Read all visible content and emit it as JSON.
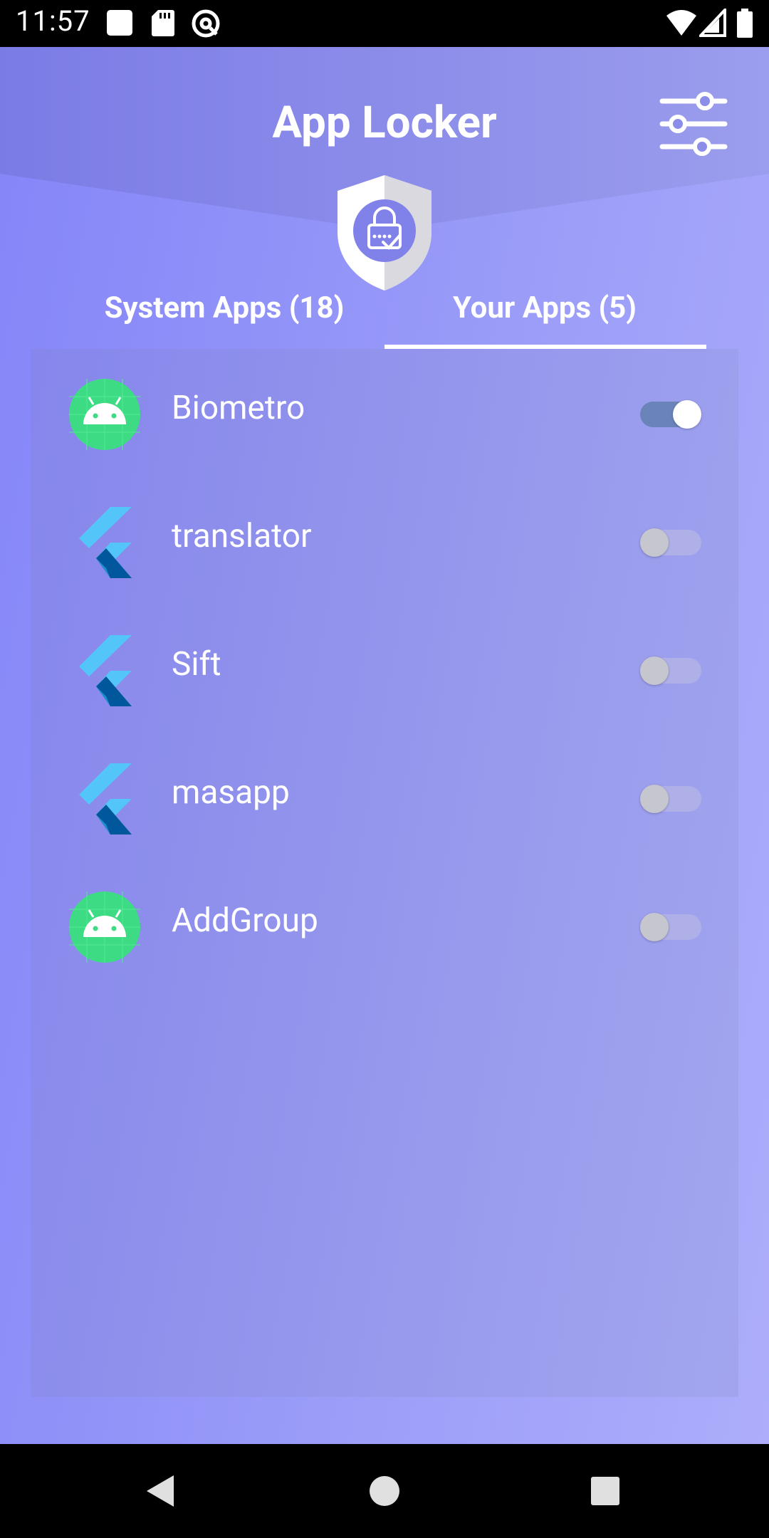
{
  "status_bar": {
    "time": "11:57",
    "left_icons": [
      "app-notification-icon",
      "sd-card-icon",
      "at-sign-icon"
    ],
    "right_icons": [
      "wifi-icon",
      "cellular-signal-icon",
      "battery-icon"
    ]
  },
  "header": {
    "title": "App Locker",
    "filter_icon": "sliders-icon",
    "shield_icon": "shield-lock-icon"
  },
  "tabs": [
    {
      "label": "System Apps (18)",
      "selected": false
    },
    {
      "label": "Your Apps (5)",
      "selected": true
    }
  ],
  "apps": [
    {
      "name": "Biometro",
      "icon": "android-icon",
      "locked": true
    },
    {
      "name": "translator",
      "icon": "flutter-icon",
      "locked": false
    },
    {
      "name": "Sift",
      "icon": "flutter-icon",
      "locked": false
    },
    {
      "name": "masapp",
      "icon": "flutter-icon",
      "locked": false
    },
    {
      "name": "AddGroup",
      "icon": "android-icon",
      "locked": false
    }
  ],
  "nav_bar": {
    "buttons": [
      "back-icon",
      "home-icon",
      "recents-icon"
    ]
  },
  "colors": {
    "background": "#8f8ff2",
    "toggle_on_track": "#6a83b8",
    "android_icon": "#3ddc84",
    "flutter_light": "#54c5f8",
    "flutter_dark": "#01579b"
  }
}
